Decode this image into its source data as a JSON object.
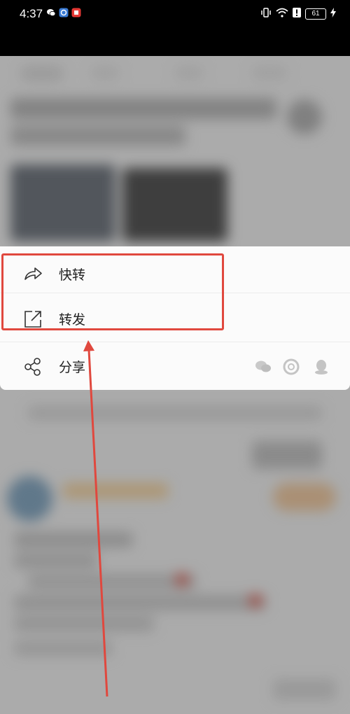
{
  "status_bar": {
    "time": "4:37",
    "battery": "61"
  },
  "share_menu": {
    "items": [
      {
        "label": "快转",
        "icon": "quick-repost-icon"
      },
      {
        "label": "转发",
        "icon": "repost-icon"
      },
      {
        "label": "分享",
        "icon": "share-icon"
      }
    ],
    "share_targets": [
      "wechat-icon",
      "moments-icon",
      "qq-icon"
    ]
  },
  "colors": {
    "highlight": "#e0483e",
    "menu_bg": "#fbfbfb",
    "overlay": "#d6d6d6"
  }
}
